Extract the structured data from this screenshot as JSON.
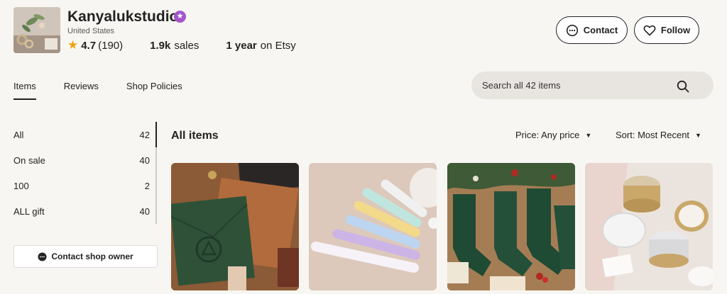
{
  "shop": {
    "name": "Kanyalukstudio",
    "badge_icon": "star-seller-icon",
    "location": "United States",
    "rating": "4.7",
    "review_count": "(190)",
    "sales_value": "1.9k",
    "sales_label": "sales",
    "years_value": "1 year",
    "years_label": "on Etsy"
  },
  "actions": {
    "contact_label": "Contact",
    "follow_label": "Follow"
  },
  "tabs": [
    {
      "label": "Items",
      "active": true
    },
    {
      "label": "Reviews",
      "active": false
    },
    {
      "label": "Shop Policies",
      "active": false
    }
  ],
  "search": {
    "placeholder": "Search all 42 items"
  },
  "sidebar": {
    "items": [
      {
        "label": "All",
        "count": "42"
      },
      {
        "label": "On sale",
        "count": "40"
      },
      {
        "label": "100",
        "count": "2"
      },
      {
        "label": "ALL gift",
        "count": "40"
      }
    ],
    "contact_owner_label": "Contact shop owner"
  },
  "listing": {
    "title": "All items",
    "price_filter": "Price: Any price",
    "sort_filter": "Sort: Most Recent"
  },
  "colors": {
    "background": "#f8f6f2",
    "star_seller": "#a355c8",
    "rating_star": "#f1a10d",
    "search_bg": "#e8e5e0"
  }
}
